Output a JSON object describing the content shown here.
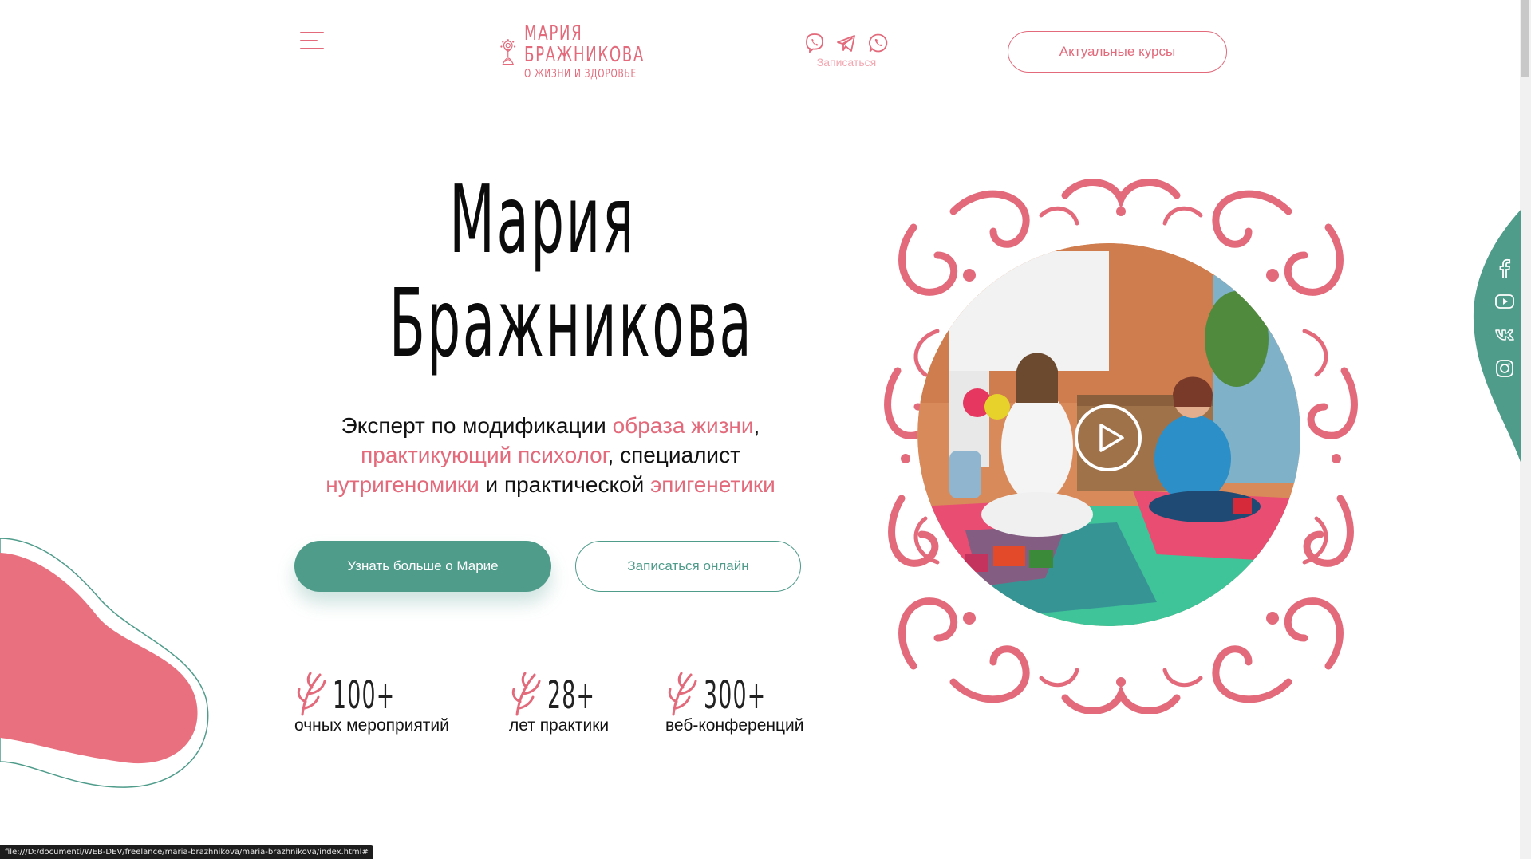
{
  "header": {
    "logo": {
      "line1": "МАРИЯ",
      "line2": "БРАЖНИКОВА",
      "line3": "О ЖИЗНИ И ЗДОРОВЬЕ"
    },
    "messengers": {
      "icons": [
        "viber-icon",
        "telegram-icon",
        "whatsapp-icon"
      ],
      "label": "Записаться"
    },
    "courses_button": "Актуальные курсы"
  },
  "hero": {
    "title_line1": "Мария",
    "title_line2": "Бражникова",
    "description": {
      "p1": "Эксперт по модификации ",
      "h1": "образа жизни",
      "p2": ",",
      "h2": "практикующий психолог",
      "p3": ", специалист",
      "h3": "нутригеномики",
      "p4": " и практической ",
      "h4": "эпигенетики"
    },
    "button_more": "Узнать больше о Марие",
    "button_signup": "Записаться онлайн"
  },
  "stats": [
    {
      "value": "100+",
      "label": "очных мероприятий"
    },
    {
      "value": "28+",
      "label": "лет практики"
    },
    {
      "value": "300+",
      "label": "веб-конференций"
    }
  ],
  "social": [
    "facebook-icon",
    "youtube-icon",
    "vk-icon",
    "instagram-icon"
  ],
  "status_bar": "file:///D:/documenti/WEB-DEV/freelance/maria-brazhnikova/maria-brazhnikova/index.html#",
  "colors": {
    "accent_pink": "#e26a7b",
    "accent_green": "#4f9c8b",
    "text": "#111111"
  }
}
